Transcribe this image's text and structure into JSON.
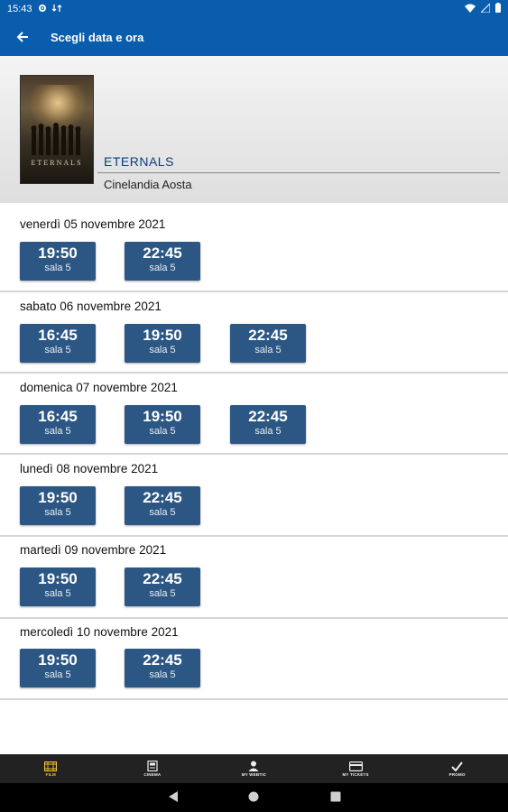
{
  "status_bar": {
    "time": "15:43"
  },
  "app_bar": {
    "title": "Scegli data e ora"
  },
  "movie": {
    "poster_title": "ETERNALS",
    "title": "ETERNALS",
    "cinema": "Cinelandia Aosta"
  },
  "days": [
    {
      "label": "venerdì 05 novembre 2021",
      "shows": [
        {
          "time": "19:50",
          "room": "sala 5"
        },
        {
          "time": "22:45",
          "room": "sala 5"
        }
      ]
    },
    {
      "label": "sabato 06 novembre 2021",
      "shows": [
        {
          "time": "16:45",
          "room": "sala 5"
        },
        {
          "time": "19:50",
          "room": "sala 5"
        },
        {
          "time": "22:45",
          "room": "sala 5"
        }
      ]
    },
    {
      "label": "domenica 07 novembre 2021",
      "shows": [
        {
          "time": "16:45",
          "room": "sala 5"
        },
        {
          "time": "19:50",
          "room": "sala 5"
        },
        {
          "time": "22:45",
          "room": "sala 5"
        }
      ]
    },
    {
      "label": "lunedì 08 novembre 2021",
      "shows": [
        {
          "time": "19:50",
          "room": "sala 5"
        },
        {
          "time": "22:45",
          "room": "sala 5"
        }
      ]
    },
    {
      "label": "martedì 09 novembre 2021",
      "shows": [
        {
          "time": "19:50",
          "room": "sala 5"
        },
        {
          "time": "22:45",
          "room": "sala 5"
        }
      ]
    },
    {
      "label": "mercoledì 10 novembre 2021",
      "shows": [
        {
          "time": "19:50",
          "room": "sala 5"
        },
        {
          "time": "22:45",
          "room": "sala 5"
        }
      ]
    }
  ],
  "bottom_nav": [
    {
      "label": "FILM",
      "icon": "film-icon",
      "active": true
    },
    {
      "label": "CINEMA",
      "icon": "cinema-icon",
      "active": false
    },
    {
      "label": "MY WEBTIC",
      "icon": "person-icon",
      "active": false
    },
    {
      "label": "MY TICKETS",
      "icon": "ticket-card-icon",
      "active": false
    },
    {
      "label": "PROMO",
      "icon": "check-icon",
      "active": false
    }
  ],
  "colors": {
    "primary": "#0a5cad",
    "showtime_button": "#2c5784",
    "nav_active": "#f2c230",
    "nav_bg": "#222222"
  }
}
